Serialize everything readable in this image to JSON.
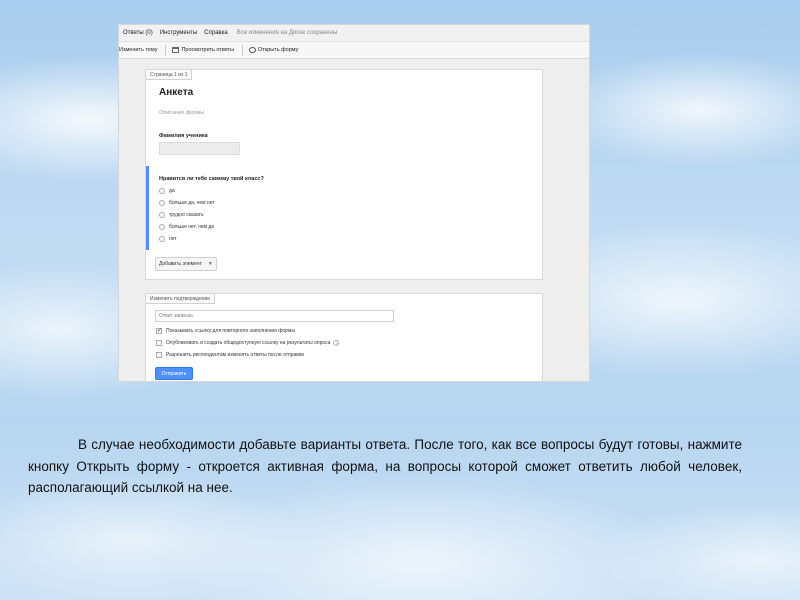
{
  "editor": {
    "menu": {
      "items": [
        "Ответы (0)",
        "Инструменты",
        "Справка"
      ],
      "save_status": "Все изменения на Диске сохранены"
    },
    "toolbar": {
      "change_theme": "Изменить тему",
      "view_responses": "Просмотреть ответы",
      "open_form": "Открыть форму"
    },
    "form": {
      "page_indicator": "Страница 1 из 1",
      "title": "Анкета",
      "description_placeholder": "Описание формы",
      "question1": {
        "label": "Фамилия ученика"
      },
      "question2": {
        "label": "Нравится ли тебе самому твой класс?",
        "options": [
          "да",
          "больше да, чем нет",
          "трудно сказать",
          "больше нет, чем да",
          "нет"
        ]
      },
      "add_item_label": "Добавить элемент"
    },
    "confirmation": {
      "tab_label": "Изменить подтверждение",
      "message_value": "Ответ записан.",
      "checkboxes": [
        {
          "label": "Показывать ссылку для повторного заполнения формы",
          "checked": true
        },
        {
          "label": "Опубликовать и создать общедоступную ссылку на результаты опроса",
          "checked": false
        },
        {
          "label": "Разрешить респондентам изменять ответы после отправки",
          "checked": false
        }
      ],
      "submit_label": "Отправить"
    }
  },
  "caption": {
    "text": "В случае необходимости добавьте варианты ответа. После того, как все вопросы будут готовы, нажмите кнопку Открыть форму - откроется активная форма, на вопросы которой сможет ответить любой человек, располагающий  ссылкой на нее."
  },
  "colors": {
    "accent_blue": "#4d90fe"
  }
}
